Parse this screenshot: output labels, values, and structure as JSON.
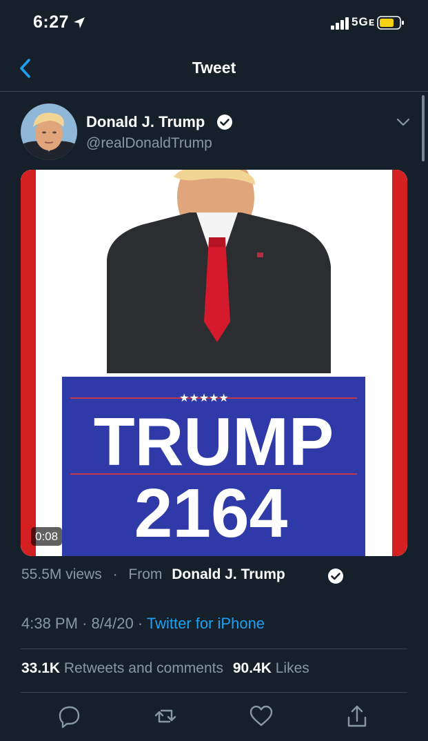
{
  "status_bar": {
    "time": "6:27",
    "network": "5Gᴇ",
    "icons": [
      "location-arrow-icon",
      "signal-bars-icon",
      "battery-icon"
    ],
    "battery_color": "#f5d20d"
  },
  "nav": {
    "title": "Tweet",
    "back_icon": "chevron-left-icon"
  },
  "tweet": {
    "author_name": "Donald J. Trump",
    "author_handle": "@realDonaldTrump",
    "verified": true,
    "menu_icon": "chevron-down-icon",
    "media": {
      "sign_line1": "TRUMP",
      "sign_line2": "2164",
      "sign_stars": "★★★★★",
      "duration": "0:08",
      "colors": {
        "sign_blue": "#2f3aa8",
        "border_red": "#d42020",
        "tie_red": "#d41a2c"
      }
    },
    "views": "55.5M views",
    "separator": "·",
    "from_label": "From",
    "source_name": "Donald J. Trump",
    "time": "4:38 PM",
    "date": "8/4/20",
    "meta_sep": "·",
    "client": "Twitter for iPhone",
    "retweets_count": "33.1K",
    "retweets_label": "Retweets and comments",
    "likes_count": "90.4K",
    "likes_label": "Likes"
  },
  "actions": [
    "reply-icon",
    "retweet-icon",
    "like-icon",
    "share-icon"
  ],
  "colors": {
    "background": "#15202b",
    "accent": "#1da1f2",
    "muted_text": "#8899a6",
    "divider": "#38444d"
  }
}
